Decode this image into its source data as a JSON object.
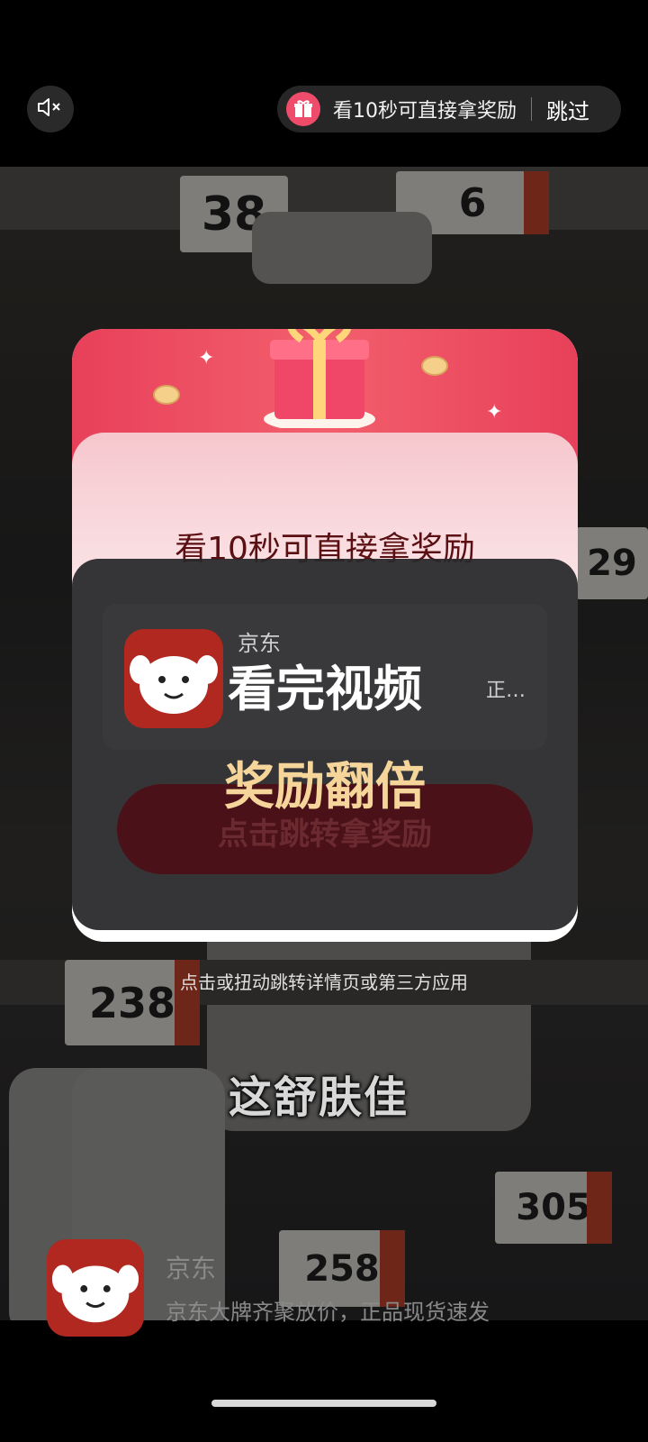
{
  "top_bar": {
    "mute_icon": "speaker-muted-icon",
    "reward_pill": {
      "gift_icon": "gift-icon",
      "text": "看10秒可直接拿奖励",
      "skip_label": "跳过"
    }
  },
  "video": {
    "caption": "这舒肤佳",
    "price_tags": [
      "38",
      "6",
      "29",
      "238",
      "305",
      "258"
    ]
  },
  "reward_card": {
    "title": "看10秒可直接拿奖励",
    "app_name": "京东",
    "app_desc": "正…",
    "cta_label": "点击跳转拿奖励"
  },
  "overlay": {
    "title": "看完视频",
    "subtitle": "奖励翻倍"
  },
  "hint": "点击或扭动跳转详情页或第三方应用",
  "ad": {
    "app_name": "京东",
    "description": "京东大牌齐聚放价，正品现货速发"
  },
  "colors": {
    "accent_red": "#e8405a",
    "gold_text": "#f6d59b",
    "brand_red": "#b0281f"
  }
}
